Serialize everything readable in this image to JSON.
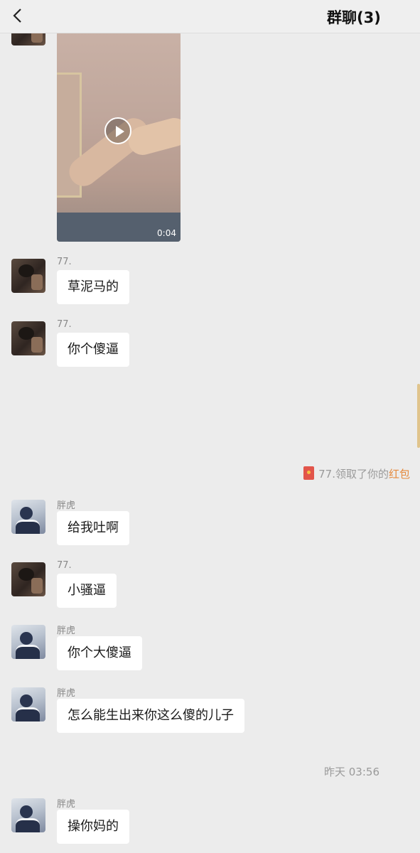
{
  "header": {
    "title": "群聊(3)"
  },
  "video": {
    "duration": "0:04"
  },
  "messages": [
    {
      "sender": "77.",
      "text": "草泥马的"
    },
    {
      "sender": "77.",
      "text": "你个傻逼"
    },
    {
      "sender": "胖虎",
      "text": "给我吐啊"
    },
    {
      "sender": "77.",
      "text": "小骚逼"
    },
    {
      "sender": "胖虎",
      "text": "你个大傻逼"
    },
    {
      "sender": "胖虎",
      "text": "怎么能生出来你这么傻的儿子"
    },
    {
      "sender": "胖虎",
      "text": "操你妈的"
    }
  ],
  "system": {
    "red_packet_text": "77.领取了你的",
    "red_packet_link": "红包",
    "timestamp": "昨天 03:56"
  },
  "colors": {
    "background": "#ececec",
    "bubble": "#ffffff",
    "link": "#e58a3d",
    "red_packet": "#e2554a"
  }
}
